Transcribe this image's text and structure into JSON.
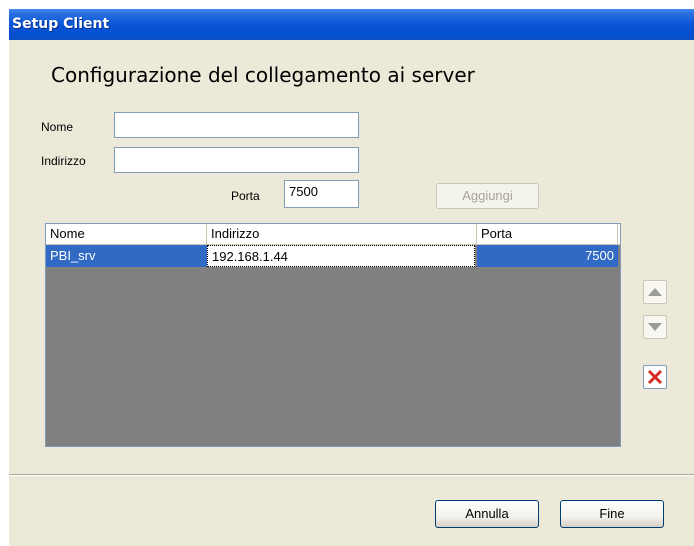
{
  "window": {
    "title": "Setup Client"
  },
  "heading": "Configurazione del collegamento ai server",
  "form": {
    "nome_label": "Nome",
    "nome_value": "",
    "indirizzo_label": "Indirizzo",
    "indirizzo_value": "",
    "porta_label": "Porta",
    "porta_value": "7500",
    "aggiungi_label": "Aggiungi"
  },
  "table": {
    "columns": [
      "Nome",
      "Indirizzo",
      "Porta"
    ],
    "rows": [
      {
        "nome": "PBI_srv",
        "indirizzo": "192.168.1.44",
        "porta": "7500"
      }
    ]
  },
  "side_buttons": {
    "up_icon": "triangle-up-icon",
    "down_icon": "triangle-down-icon",
    "delete_icon": "red-x-icon"
  },
  "footer": {
    "annulla_label": "Annulla",
    "fine_label": "Fine"
  },
  "colors": {
    "titlebar": "#0a56d8",
    "selection": "#316ac5",
    "window_bg": "#ece9d8",
    "list_bg": "#808080",
    "delete_red": "#d62b1f"
  }
}
